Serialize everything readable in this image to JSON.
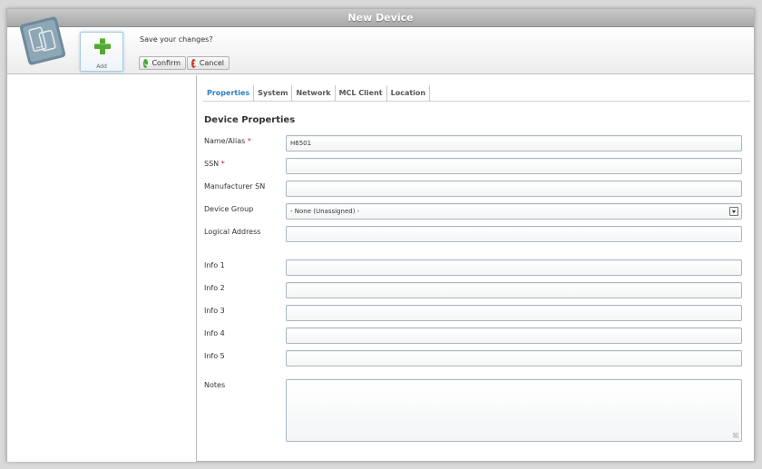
{
  "window": {
    "title": "New Device"
  },
  "toolbar": {
    "add_label": "Add",
    "save_prompt": "Save your changes?",
    "confirm_label": "Confirm",
    "cancel_label": "Cancel"
  },
  "tabs": [
    {
      "label": "Properties",
      "active": true
    },
    {
      "label": "System",
      "active": false
    },
    {
      "label": "Network",
      "active": false
    },
    {
      "label": "MCL Client",
      "active": false
    },
    {
      "label": "Location",
      "active": false
    }
  ],
  "form": {
    "section_title": "Device Properties",
    "name_alias": {
      "label": "Name/Alias",
      "required_mark": "*",
      "value": "H6501"
    },
    "ssn": {
      "label": "SSN",
      "required_mark": "*",
      "value": ""
    },
    "manufacturer_sn": {
      "label": "Manufacturer SN",
      "value": ""
    },
    "device_group": {
      "label": "Device Group",
      "value": "- None (Unassigned) -"
    },
    "logical_address": {
      "label": "Logical Address",
      "value": ""
    },
    "info1": {
      "label": "Info 1",
      "value": ""
    },
    "info2": {
      "label": "Info 2",
      "value": ""
    },
    "info3": {
      "label": "Info 3",
      "value": ""
    },
    "info4": {
      "label": "Info 4",
      "value": ""
    },
    "info5": {
      "label": "Info 5",
      "value": ""
    },
    "notes": {
      "label": "Notes",
      "value": ""
    }
  },
  "colors": {
    "accent": "#2a7fbf",
    "required": "#d21f1f",
    "confirm": "#4aa63a",
    "cancel": "#d43a2a",
    "add": "#56a834"
  },
  "icons": {
    "logo": "device-tablet-icon",
    "add": "plus-icon",
    "confirm": "checkmark-icon",
    "cancel": "close-icon",
    "select": "chevron-down-icon"
  }
}
